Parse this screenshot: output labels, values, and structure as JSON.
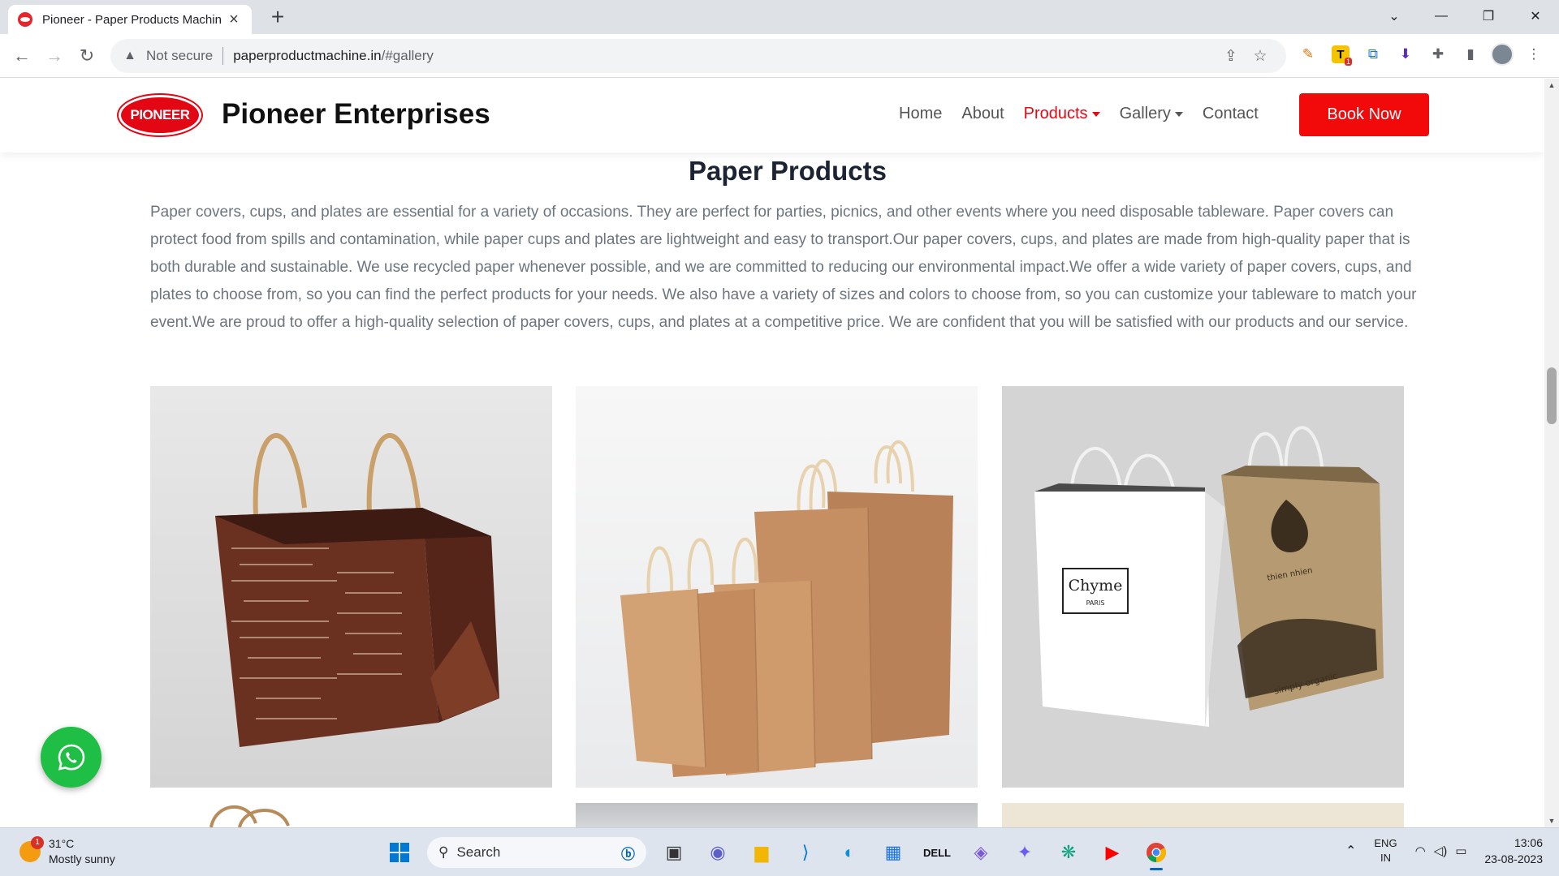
{
  "browser": {
    "tab_title": "Pioneer - Paper Products Machin",
    "security_label": "Not secure",
    "url_host": "paperproductmachine.in",
    "url_path": "/#gallery",
    "extension_badge": "1"
  },
  "site": {
    "logo_text": "PIONEER",
    "brand": "Pioneer Enterprises",
    "nav": [
      {
        "label": "Home"
      },
      {
        "label": "About"
      },
      {
        "label": "Products"
      },
      {
        "label": "Gallery"
      },
      {
        "label": "Contact"
      }
    ],
    "book_button": "Book Now",
    "accent_color": "#e50914"
  },
  "section": {
    "title": "Paper Products",
    "intro": "Paper covers, cups, and plates are essential for a variety of occasions. They are perfect for parties, picnics, and other events where you need disposable tableware. Paper covers can protect food from spills and contamination, while paper cups and plates are lightweight and easy to transport.Our paper covers, cups, and plates are made from high-quality paper that is both durable and sustainable. We use recycled paper whenever possible, and we are committed to reducing our environmental impact.We offer a wide variety of paper covers, cups, and plates to choose from, so you can find the perfect products for your needs. We also have a variety of sizes and colors to choose from, so you can customize your tableware to match your event.We are proud to offer a high-quality selection of paper covers, cups, and plates at a competitive price. We are confident that you will be satisfied with our products and our service."
  },
  "gallery": {
    "bag3_white_label": "Chyme",
    "bag3_white_sub": "PARIS",
    "bag3_kraft_top": "thien nhien",
    "bag3_kraft_bottom": "simply organic"
  },
  "taskbar": {
    "weather_temp": "31°C",
    "weather_desc": "Mostly sunny",
    "weather_badge": "1",
    "search_label": "Search",
    "lang_top": "ENG",
    "lang_bottom": "IN",
    "time": "13:06",
    "date": "23-08-2023"
  }
}
